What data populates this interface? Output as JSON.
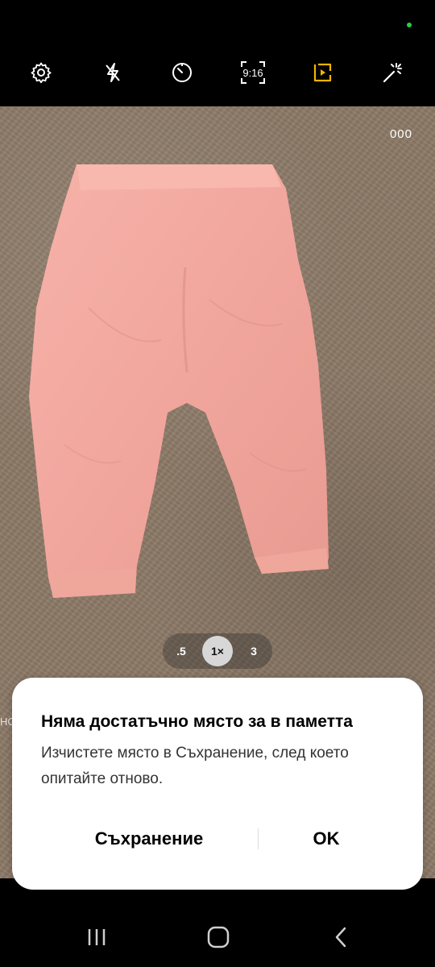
{
  "status": {
    "indicator_color": "#2ecc40"
  },
  "top_bar": {
    "settings_icon": "gear-icon",
    "flash_icon": "flash-off-icon",
    "timer_icon": "timer-icon",
    "ratio_label": "9:16",
    "motion_photo_icon": "motion-photo-icon",
    "filters_icon": "magic-wand-icon",
    "active_color": "#f5b400"
  },
  "viewfinder": {
    "counter": "000",
    "zoom": {
      "options": [
        ".5",
        "1×",
        "3"
      ],
      "selected": "1×"
    }
  },
  "dialog": {
    "title": "Няма достатъчно място за в паметта",
    "message": "Изчистете място в Съхранение, след което опитайте отново.",
    "storage_button": "Съхранение",
    "ok_button": "OK"
  },
  "side_peek_text": "НС",
  "nav_bar": {
    "recents_icon": "recents-icon",
    "home_icon": "home-icon",
    "back_icon": "back-icon"
  }
}
